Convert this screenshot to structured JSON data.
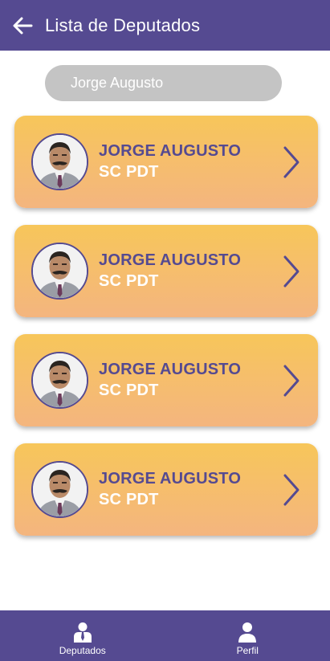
{
  "appbar": {
    "title": "Lista de Deputados",
    "back_icon": "arrow-left-icon"
  },
  "search": {
    "placeholder": "Jorge Augusto",
    "value": ""
  },
  "deputies": [
    {
      "name": "JORGE AUGUSTO",
      "party": "SC PDT"
    },
    {
      "name": "JORGE AUGUSTO",
      "party": "SC PDT"
    },
    {
      "name": "JORGE AUGUSTO",
      "party": "SC PDT"
    },
    {
      "name": "JORGE AUGUSTO",
      "party": "SC PDT"
    }
  ],
  "bottom_nav": [
    {
      "label": "Deputados",
      "icon": "people-icon"
    },
    {
      "label": "Perfil",
      "icon": "person-icon"
    }
  ],
  "colors": {
    "primary": "#554a91",
    "card_top": "#f7c65a",
    "card_bottom": "#f4b57f",
    "search_bg": "#c4c4c4"
  }
}
